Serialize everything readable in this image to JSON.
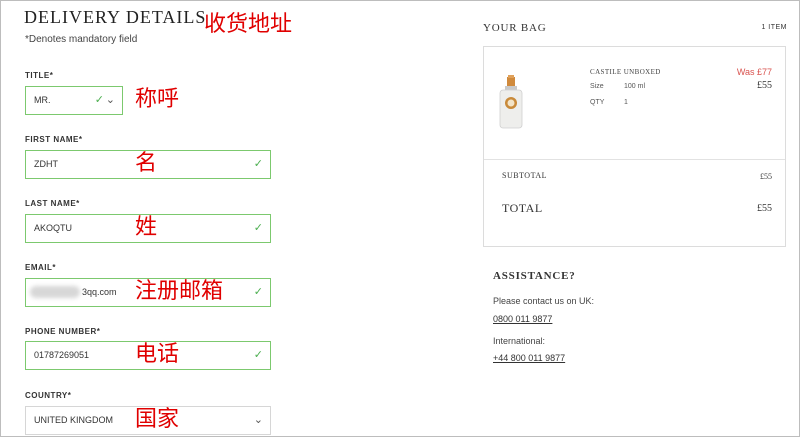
{
  "form": {
    "heading": "DELIVERY DETAILS",
    "mandatory_note": "*Denotes mandatory field",
    "title_label": "TITLE*",
    "title_value": "MR.",
    "first_name_label": "FIRST NAME*",
    "first_name_value": "ZDHT",
    "last_name_label": "LAST NAME*",
    "last_name_value": "AKOQTU",
    "email_label": "EMAIL*",
    "email_value": "3qq.com",
    "phone_label": "PHONE NUMBER*",
    "phone_value": "01787269051",
    "country_label": "COUNTRY*",
    "country_value": "UNITED KINGDOM"
  },
  "annotations": {
    "address": "收货地址",
    "title": "称呼",
    "first_name": "名",
    "last_name": "姓",
    "email": "注册邮箱",
    "phone": "电话",
    "country": "国家"
  },
  "bag": {
    "title": "YOUR BAG",
    "count": "1 ITEM",
    "product_name": "CASTILE UNBOXED",
    "was_price": "Was £77",
    "price": "£55",
    "size_label": "Size",
    "size_value": "100 ml",
    "qty_label": "QTY",
    "qty_value": "1",
    "subtotal_label": "SUBTOTAL",
    "subtotal_value": "£55",
    "total_label": "TOTAL",
    "total_value": "£55"
  },
  "assistance": {
    "heading": "ASSISTANCE?",
    "uk_text": "Please contact us on UK:",
    "uk_phone": "0800 011 9877",
    "intl_text": "International:",
    "intl_phone": "+44 800 011 9877"
  },
  "colors": {
    "valid_border": "#7cc96e",
    "check": "#4caf50",
    "annotation": "#e00000",
    "was_price": "#d9534f"
  }
}
